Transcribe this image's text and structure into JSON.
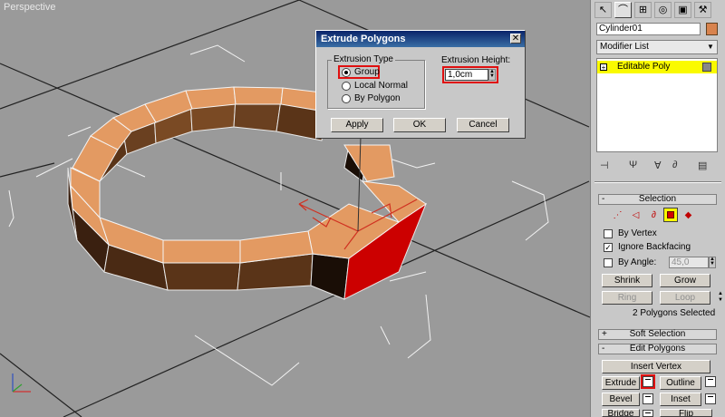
{
  "viewport": {
    "label": "Perspective"
  },
  "dialog": {
    "title": "Extrude Polygons",
    "close_label": "✕",
    "extrusion_type_label": "Extrusion Type",
    "options": [
      "Group",
      "Local Normal",
      "By Polygon"
    ],
    "selected_option": "Group",
    "extrusion_height_label": "Extrusion Height:",
    "extrusion_height_value": "1,0cm",
    "apply_label": "Apply",
    "ok_label": "OK",
    "cancel_label": "Cancel"
  },
  "panel": {
    "tabs": [
      "pointer-icon",
      "curve-icon",
      "hierarchy-icon",
      "motion-icon",
      "display-icon",
      "utilities-icon"
    ],
    "object_name": "Cylinder01",
    "object_color": "#d8834e",
    "modifier_list_label": "Modifier List",
    "stack_items": [
      {
        "label": "Editable Poly"
      }
    ],
    "selection": {
      "title": "Selection",
      "sign": "-",
      "by_vertex_label": "By Vertex",
      "by_vertex_checked": false,
      "ignore_backfacing_label": "Ignore Backfacing",
      "ignore_backfacing_checked": true,
      "by_angle_label": "By Angle:",
      "by_angle_value": "45,0",
      "shrink_label": "Shrink",
      "grow_label": "Grow",
      "ring_label": "Ring",
      "loop_label": "Loop",
      "status": "2 Polygons Selected",
      "check_mark": "✓"
    },
    "soft_selection": {
      "title": "Soft Selection",
      "sign": "+"
    },
    "edit_polygons": {
      "title": "Edit Polygons",
      "sign": "-",
      "insert_vertex_label": "Insert Vertex",
      "extrude_label": "Extrude",
      "outline_label": "Outline",
      "bevel_label": "Bevel",
      "inset_label": "Inset",
      "bridge_label": "Bridge",
      "flip_label": "Flip"
    },
    "colors": {
      "accent": "#fafa00",
      "highlight": "#e01010"
    }
  }
}
